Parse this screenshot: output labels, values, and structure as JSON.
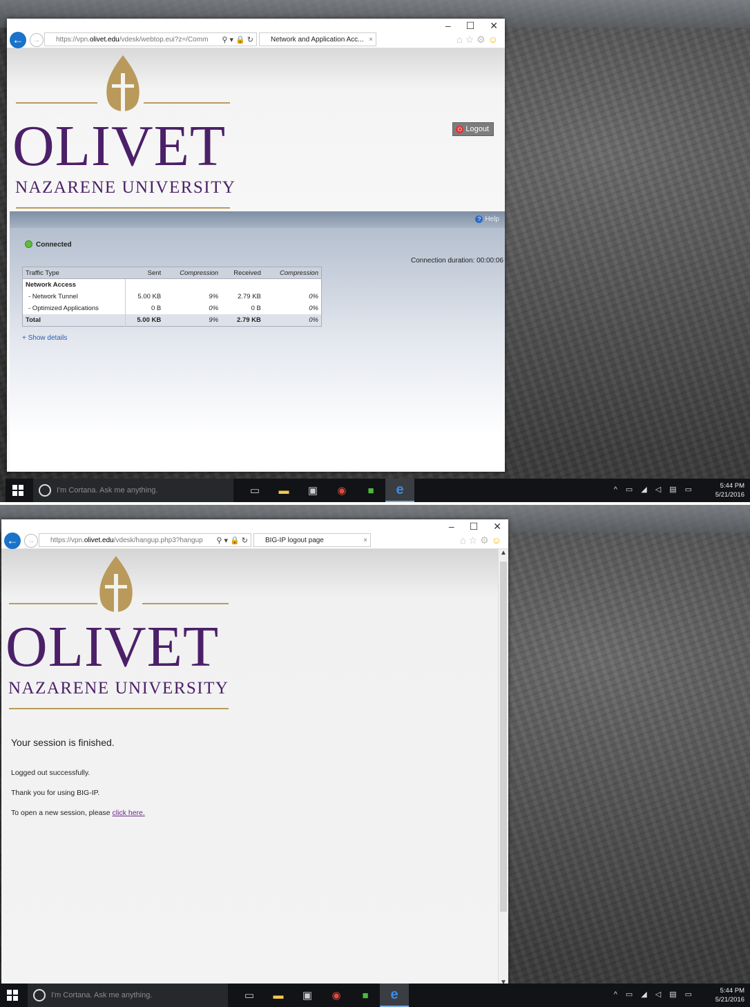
{
  "screens": [
    {
      "browser": {
        "url_prefix": "https://vpn.",
        "url_domain": "olivet.edu",
        "url_path": "/vdesk/webtop.eui?z=/Comm",
        "tab_title": "Network and Application Acc...",
        "tab_close": "×"
      },
      "logo": {
        "line1": "OLIVET",
        "line2": "NAZARENE UNIVERSITY"
      },
      "logout_label": "Logout",
      "help_label": "Help",
      "status": "Connected",
      "duration": "Connection duration: 00:00:06",
      "table": {
        "headers": [
          "Traffic Type",
          "Sent",
          "Compression",
          "Received",
          "Compression"
        ],
        "rows": [
          [
            "Network Access",
            "",
            "",
            "",
            ""
          ],
          [
            "- Network Tunnel",
            "5.00 KB",
            "9%",
            "2.79 KB",
            "0%"
          ],
          [
            "- Optimized Applications",
            "0 B",
            "0%",
            "0 B",
            "0%"
          ],
          [
            "Total",
            "5.00 KB",
            "9%",
            "2.79 KB",
            "0%"
          ]
        ]
      },
      "show_details": "+ Show details"
    },
    {
      "browser": {
        "url_prefix": "https://vpn.",
        "url_domain": "olivet.edu",
        "url_path": "/vdesk/hangup.php3?hangup",
        "tab_title": "BIG-IP logout page",
        "tab_close": "×"
      },
      "logo": {
        "line1": "OLIVET",
        "line2": "NAZARENE UNIVERSITY"
      },
      "messages": {
        "title": "Your session is finished.",
        "line1": "Logged out successfully.",
        "line2": "Thank you for using BIG-IP.",
        "line3_prefix": "To open a new session, please ",
        "line3_link": "click here."
      }
    }
  ],
  "window_controls": [
    "–",
    "☐",
    "✕"
  ],
  "taskbar": {
    "cortana_placeholder": "I'm Cortana. Ask me anything.",
    "time": "5:44 PM",
    "date": "5/21/2016"
  },
  "colors": {
    "brand_purple": "#4b2068",
    "brand_gold": "#b99a5a",
    "link_blue": "#2a5db0"
  }
}
